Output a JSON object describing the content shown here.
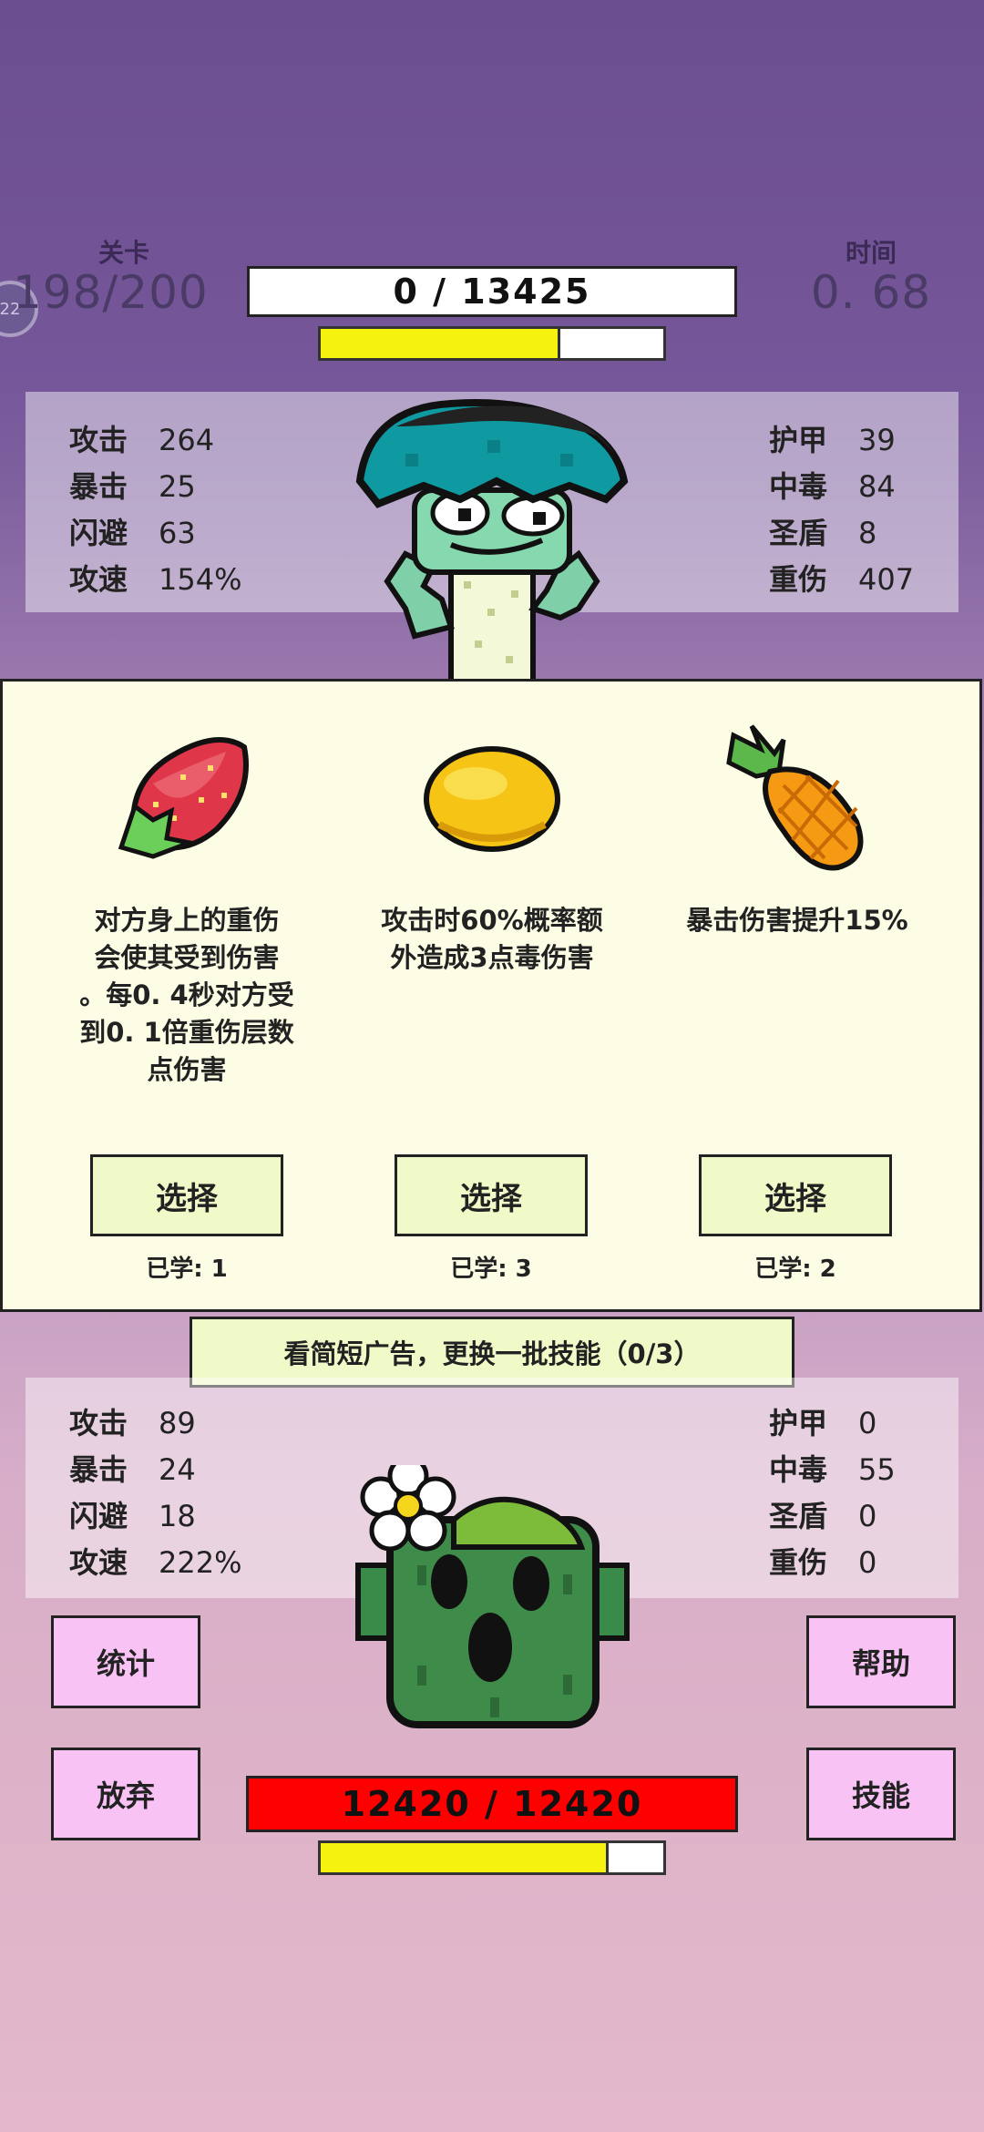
{
  "header": {
    "level_label": "关卡",
    "level_value": "198/200",
    "time_label": "时间",
    "time_value": "0. 68",
    "menu_badge": "22",
    "player_damage": "0 / 13425",
    "player_progress": 0.7
  },
  "player_stats": {
    "left": [
      {
        "key": "攻击",
        "value": "264"
      },
      {
        "key": "暴击",
        "value": "25"
      },
      {
        "key": "闪避",
        "value": "63"
      },
      {
        "key": "攻速",
        "value": "154%"
      }
    ],
    "right": [
      {
        "key": "护甲",
        "value": "39"
      },
      {
        "key": "中毒",
        "value": "84"
      },
      {
        "key": "圣盾",
        "value": "8"
      },
      {
        "key": "重伤",
        "value": "407"
      }
    ]
  },
  "skills": [
    {
      "icon": "strawberry-icon",
      "desc": [
        "对方身上的重伤",
        "会使其受到伤害",
        "。每0. 4秒对方受",
        "到0. 1倍重伤层数",
        "点伤害"
      ],
      "button": "选择",
      "learned": "已学: 1"
    },
    {
      "icon": "lemon-icon",
      "desc": [
        "攻击时60%概率额",
        "外造成3点毒伤害"
      ],
      "button": "选择",
      "learned": "已学: 3"
    },
    {
      "icon": "pineapple-icon",
      "desc": [
        "暴击伤害提升15%"
      ],
      "button": "选择",
      "learned": "已学: 2"
    }
  ],
  "ad_text": "看简短广告，更换一批技能（0/3）",
  "enemy_stats": {
    "left": [
      {
        "key": "攻击",
        "value": "89"
      },
      {
        "key": "暴击",
        "value": "24"
      },
      {
        "key": "闪避",
        "value": "18"
      },
      {
        "key": "攻速",
        "value": "222%"
      }
    ],
    "right": [
      {
        "key": "护甲",
        "value": "0"
      },
      {
        "key": "中毒",
        "value": "55"
      },
      {
        "key": "圣盾",
        "value": "0"
      },
      {
        "key": "重伤",
        "value": "0"
      }
    ]
  },
  "buttons": {
    "stats": "统计",
    "help": "帮助",
    "give_up": "放弃",
    "skills": "技能"
  },
  "enemy": {
    "hp": "12420 / 12420",
    "progress": 0.84
  },
  "colors": {
    "progress_yellow": "#f4f20e",
    "enemy_hp_red": "#ff0000",
    "button_pink": "#f8c2f4",
    "button_green": "#f0fac8",
    "card_bg": "#fdfde6"
  }
}
